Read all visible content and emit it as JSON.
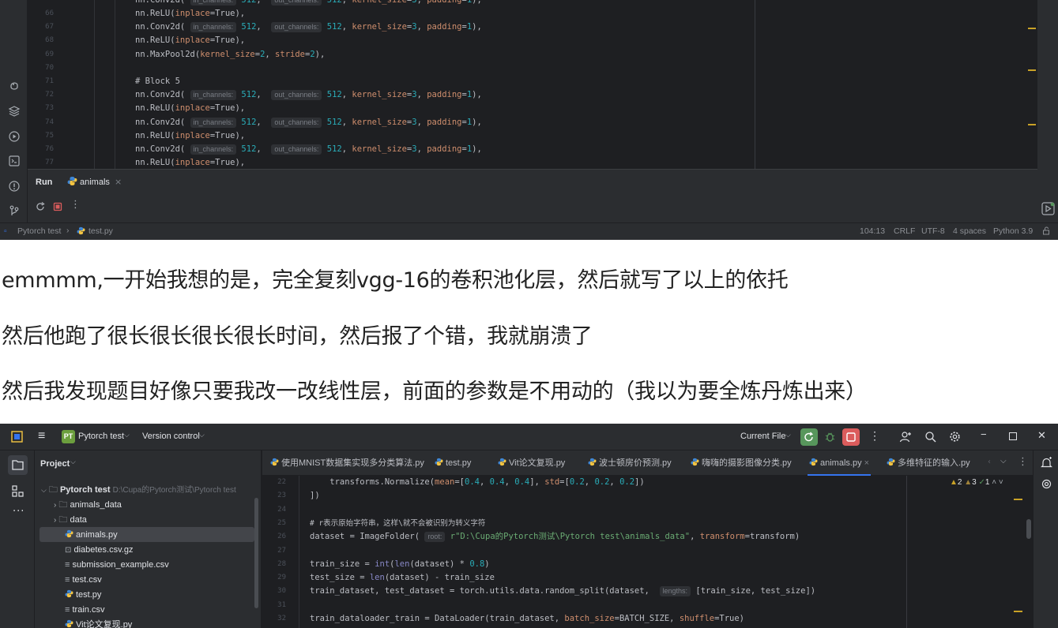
{
  "ide1": {
    "code_lines": [
      {
        "n": "66"
      },
      {
        "n": "67"
      },
      {
        "n": "68"
      },
      {
        "n": "69"
      },
      {
        "n": "70"
      },
      {
        "n": "71"
      },
      {
        "n": "72"
      },
      {
        "n": "73"
      },
      {
        "n": "74"
      },
      {
        "n": "75"
      },
      {
        "n": "76"
      },
      {
        "n": "77"
      }
    ],
    "t": {
      "conv": "nn.Conv2d(",
      "relu": "nn.ReLU(",
      "pool": "nn.MaxPool2d(",
      "in_hint": "in_channels:",
      "out_hint": "out_channels:",
      "n512": "512",
      "n3": "3",
      "n1": "1",
      "n2": "2",
      "comma": ", ",
      "ks": "kernel_size",
      "pad": "padding",
      "stride": "stride",
      "inplace": "inplace",
      "eq": "=",
      "true_close": "True),",
      "close": "),",
      "block5": "# Block 5"
    },
    "run": {
      "label": "Run",
      "tab": "animals"
    },
    "status": {
      "project": "Pytorch test",
      "file": "test.py",
      "position": "104:13",
      "line_sep": "CRLF",
      "encoding": "UTF-8",
      "indent": "4 spaces",
      "interpreter": "Python 3.9"
    }
  },
  "paragraphs": [
    "emmmm,一开始我想的是，完全复刻vgg-16的卷积池化层，然后就写了以上的依托",
    "然后他跑了很长很长很长很长时间，然后报了个错，我就崩溃了",
    "然后我发现题目好像只要我改一改线性层，前面的参数是不用动的（我以为要全炼丹炼出来）"
  ],
  "ide2": {
    "title": {
      "project_badge": "PT",
      "project": "Pytorch test",
      "vcs": "Version control",
      "run_config": "Current File"
    },
    "project_panel": {
      "title": "Project",
      "root": "Pytorch test",
      "root_path": "D:\\Cupa的Pytorch测试\\Pytorch test",
      "items": [
        "animals_data",
        "data",
        "animals.py",
        "diabetes.csv.gz",
        "submission_example.csv",
        "test.csv",
        "test.py",
        "train.csv",
        "Vit论文复现.py"
      ]
    },
    "tabs": [
      "使用MNIST数据集实现多分类算法.py",
      "test.py",
      "Vit论文复现.py",
      "波士顿房价预测.py",
      "嗨嗨的摄影图像分类.py",
      "animals.py",
      "多维特征的输入.py"
    ],
    "inspections": {
      "warn": "2",
      "weak": "3",
      "ok": "1"
    },
    "line_numbers": [
      "22",
      "23",
      "24",
      "25",
      "26",
      "27",
      "28",
      "29",
      "30",
      "31",
      "32"
    ],
    "code": {
      "l22a": "    transforms.Normalize(",
      "mean": "mean",
      "l22b": "=[",
      "v04a": "0.4",
      "v04b": "0.4",
      "v04c": "0.4",
      "l22c": "], ",
      "std": "std",
      "v02a": "0.2",
      "v02b": "0.2",
      "v02c": "0.2",
      "l22d": "])",
      "l23": "])",
      "l25": "# r表示原始字符串，这样\\就不会被识别为转义字符",
      "l26a": "dataset = ImageFolder(",
      "root_hint": "root:",
      "l26str": "r\"D:\\Cupa的Pytorch测试\\Pytorch test\\animals_data\"",
      "transform": "transform",
      "l26b": "=transform)",
      "l28a": "train_size = ",
      "int": "int",
      "len": "len",
      "l28b": "(dataset) * ",
      "v08": "0.8",
      "l28c": ")",
      "l29a": "test_size = ",
      "l29b": "(dataset) - train_size",
      "l30a": "train_dataset, test_dataset = torch.utils.data.random_split(dataset, ",
      "lengths_hint": "lengths:",
      "l30b": "[train_size, test_size])",
      "l32a": "train_dataloader_train = DataLoader(train_dataset, ",
      "batch": "batch_size",
      "l32b": "=BATCH_SIZE, ",
      "shuffle": "shuffle",
      "l32c": "=True)"
    }
  },
  "colors": {
    "bg": "#1e1f22",
    "panel": "#2b2d30",
    "number": "#2aacb8",
    "keyword_arg": "#cf8e6d",
    "comment": "#7a7e85",
    "string": "#6aab73",
    "accent": "#3574f0",
    "warning": "#c9a227"
  }
}
